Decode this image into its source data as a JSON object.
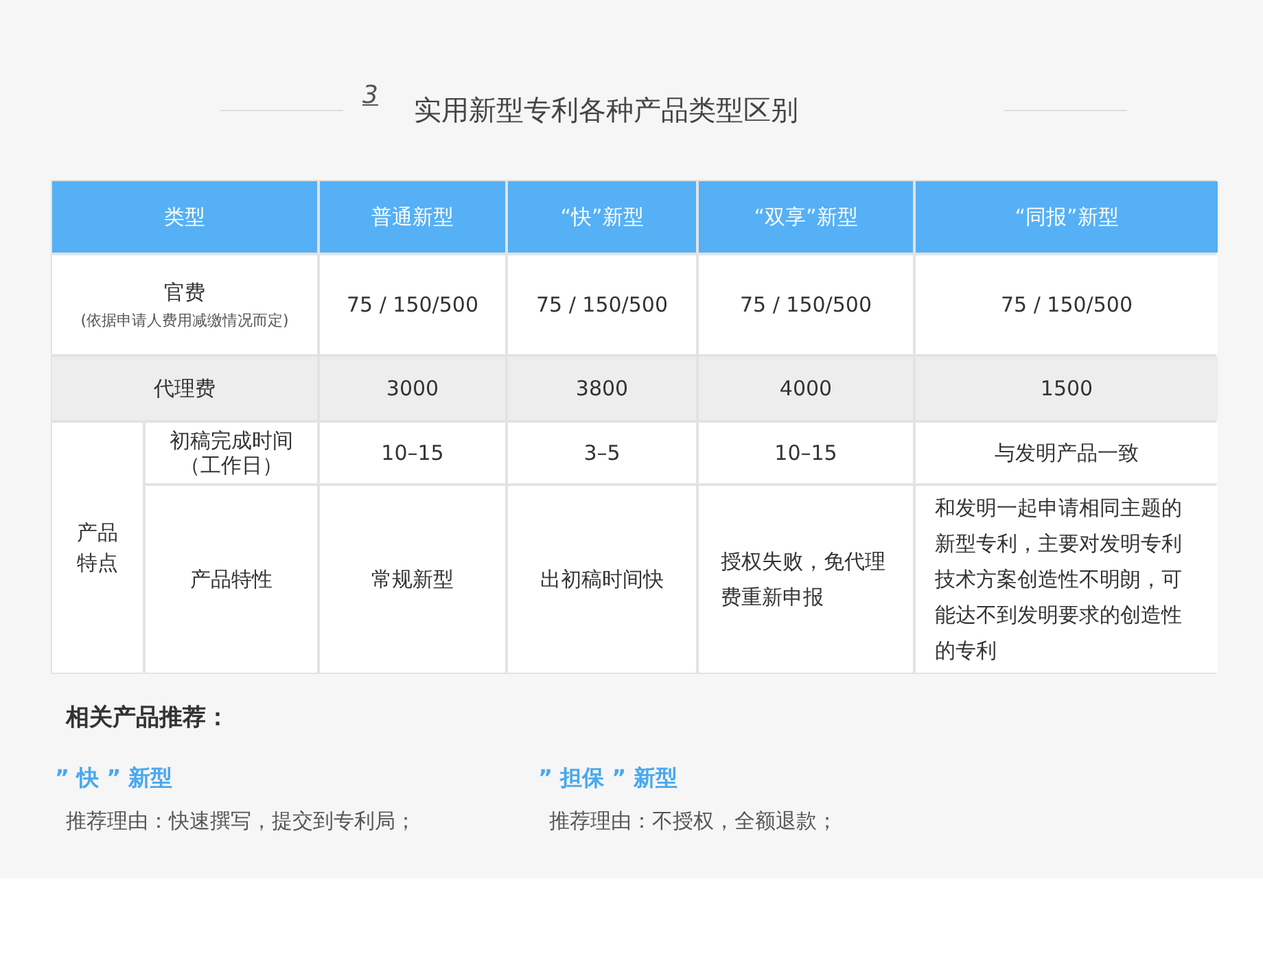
{
  "section_number": "3",
  "title": "实用新型专利各种产品类型区别",
  "table": {
    "columns": [
      "类型",
      "普通新型",
      "“快”新型",
      "“双享”新型",
      "“同报”新型"
    ],
    "rows": [
      {
        "cells": [
          "官费",
          "75 / 150/500",
          "75 / 150/500",
          "75 / 150/500",
          "75 / 150/500"
        ],
        "note": "(依据申请人费用减缴情况而定)",
        "shaded": false
      },
      {
        "cells": [
          "代理费",
          "3000",
          "3800",
          "4000",
          "1500"
        ],
        "shaded": true
      }
    ],
    "group": {
      "label": "产品特点",
      "rows": [
        {
          "cells": [
            "初稿完成时间",
            "10–15",
            "3–5",
            "10–15",
            "与发明产品一致"
          ],
          "note": "（工作日）"
        },
        {
          "cells": [
            "产品特性",
            "常规新型",
            "出初稿时间快",
            "授权失败，免代理费重新申报",
            "和发明一起申请相同主题的新型专利，主要对发明专利技术方案创造性不明朗，可能达不到发明要求的创造性的专利"
          ]
        }
      ]
    }
  },
  "recommendations": {
    "heading": "相关产品推荐：",
    "items": [
      {
        "title": "” 快 ” 新型",
        "reason": "推荐理由：快速撰写，提交到专利局；"
      },
      {
        "title": "” 担保 ” 新型",
        "reason": "推荐理由：不授权，全额退款；"
      }
    ]
  }
}
